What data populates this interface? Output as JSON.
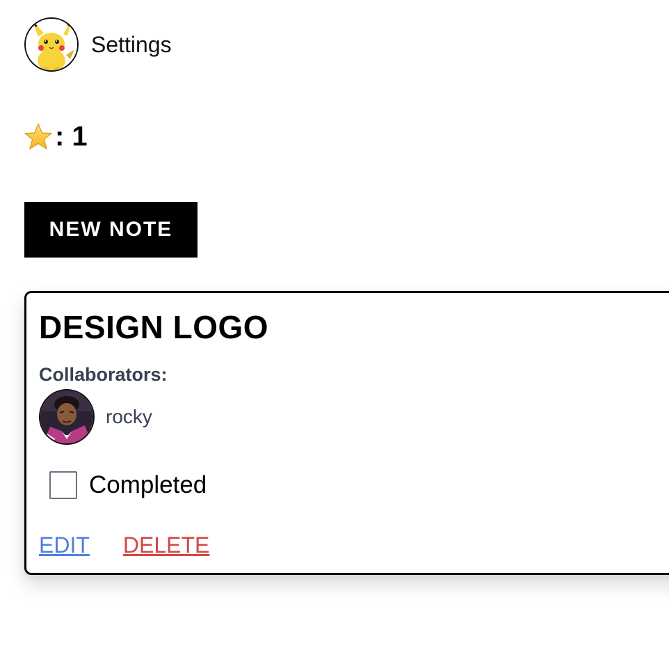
{
  "header": {
    "settings_label": "Settings"
  },
  "stars": {
    "separator_and_count": ": 1",
    "count": 1
  },
  "toolbar": {
    "new_note_label": "NEW NOTE"
  },
  "note": {
    "title": "DESIGN LOGO",
    "collaborators_label": "Collaborators:",
    "collaborators": [
      {
        "name": "rocky"
      }
    ],
    "completed_label": "Completed",
    "completed": false,
    "edit_label": "EDIT",
    "delete_label": "DELETE"
  },
  "colors": {
    "primary_button": "#000000",
    "edit_link": "#4f7fe0",
    "delete_link": "#d64545",
    "muted_text": "#374151"
  }
}
